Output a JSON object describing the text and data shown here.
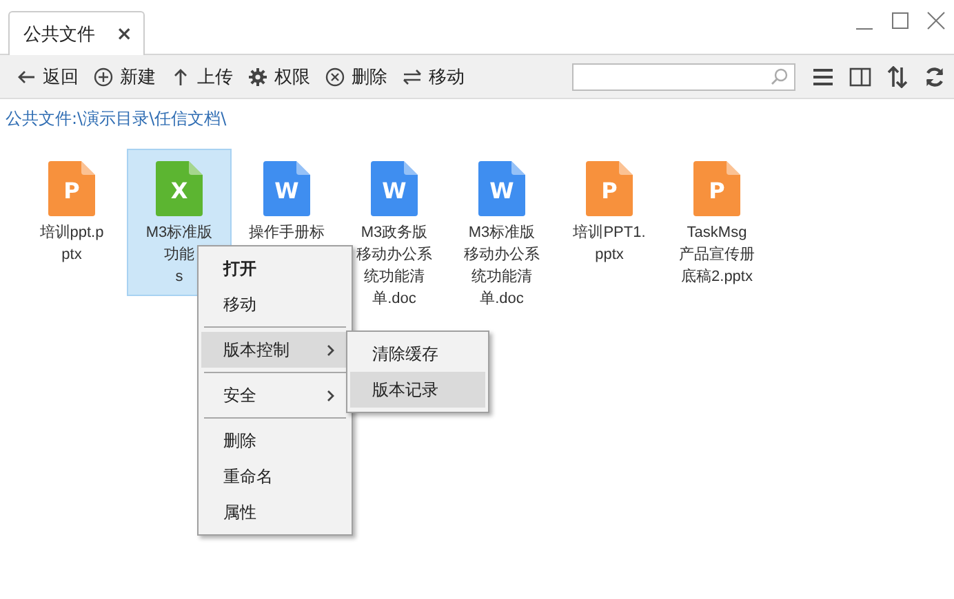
{
  "tab": {
    "title": "公共文件",
    "close": "×",
    "selected": true
  },
  "toolbar": [
    {
      "kind": "back",
      "label": "返回"
    },
    {
      "kind": "new",
      "label": "新建"
    },
    {
      "kind": "upload",
      "label": "上传"
    },
    {
      "kind": "permissions",
      "label": "权限"
    },
    {
      "kind": "delete",
      "label": "删除"
    },
    {
      "kind": "move",
      "label": "移动"
    }
  ],
  "view_buttons": [
    {
      "kind": "list"
    },
    {
      "kind": "panel"
    },
    {
      "kind": "sort"
    },
    {
      "kind": "refresh"
    }
  ],
  "breadcrumb": "公共文件:\\演示目录\\任信文档\\",
  "files": [
    {
      "kind": "ppt",
      "badge": "P",
      "lines": [
        "培训ppt.p",
        "ptx"
      ],
      "selected": false
    },
    {
      "kind": "xls",
      "badge": "X",
      "lines": [
        "M3标准版",
        "功能",
        "s"
      ],
      "selected": true
    },
    {
      "kind": "doc",
      "badge": "W",
      "lines": [
        "操作手册标"
      ],
      "selected": false
    },
    {
      "kind": "doc",
      "badge": "W",
      "lines": [
        "M3政务版",
        "移动办公系",
        "统功能清",
        "单.doc"
      ],
      "selected": false
    },
    {
      "kind": "doc",
      "badge": "W",
      "lines": [
        "M3标准版",
        "移动办公系",
        "统功能清",
        "单.doc"
      ],
      "selected": false
    },
    {
      "kind": "ppt",
      "badge": "P",
      "lines": [
        "培训PPT1.",
        "pptx"
      ],
      "selected": false
    },
    {
      "kind": "ppt",
      "badge": "P",
      "lines": [
        "TaskMsg",
        "产品宣传册",
        "底稿2.pptx"
      ],
      "selected": false
    }
  ],
  "context_menu": [
    {
      "kind": "item",
      "label": "打开",
      "default": true,
      "selected": false
    },
    {
      "kind": "item",
      "label": "移动",
      "default": false,
      "selected": false
    },
    {
      "kind": "separator"
    },
    {
      "kind": "submenu",
      "label": "版本控制",
      "default": false,
      "selected": true
    },
    {
      "kind": "separator"
    },
    {
      "kind": "submenu",
      "label": "安全",
      "default": false,
      "selected": false
    },
    {
      "kind": "separator"
    },
    {
      "kind": "item",
      "label": "删除",
      "default": false,
      "selected": false
    },
    {
      "kind": "item",
      "label": "重命名",
      "default": false,
      "selected": false
    },
    {
      "kind": "item",
      "label": "属性",
      "default": false,
      "selected": false
    }
  ],
  "submenu": [
    {
      "label": "清除缓存",
      "selected": false
    },
    {
      "label": "版本记录",
      "selected": true
    }
  ]
}
